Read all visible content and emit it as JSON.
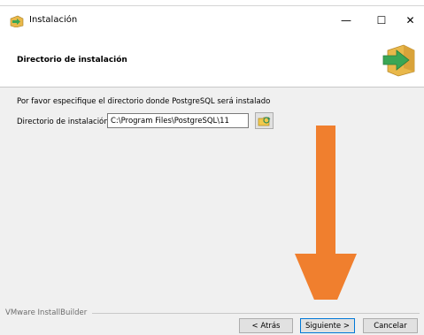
{
  "window": {
    "title": "Instalación",
    "minimize_glyph": "—",
    "maximize_glyph": "☐",
    "close_glyph": "✕"
  },
  "header": {
    "title": "Directorio de instalación",
    "logo_icon": "installer-arrow-box-icon"
  },
  "main": {
    "description": "Por favor especifique el directorio donde PostgreSQL será instalado",
    "directory_label": "Directorio de instalación",
    "directory_value": "C:\\Program Files\\PostgreSQL\\11",
    "browse_icon": "folder-browse-icon"
  },
  "footer": {
    "brand": "VMware InstallBuilder",
    "back_label": "< Atrás",
    "next_label": "Siguiente >",
    "cancel_label": "Cancelar"
  },
  "colors": {
    "arrow": "#f07f2e",
    "accent_focus": "#0078d7",
    "logo_green": "#3aa655",
    "logo_box": "#e9b84a"
  }
}
